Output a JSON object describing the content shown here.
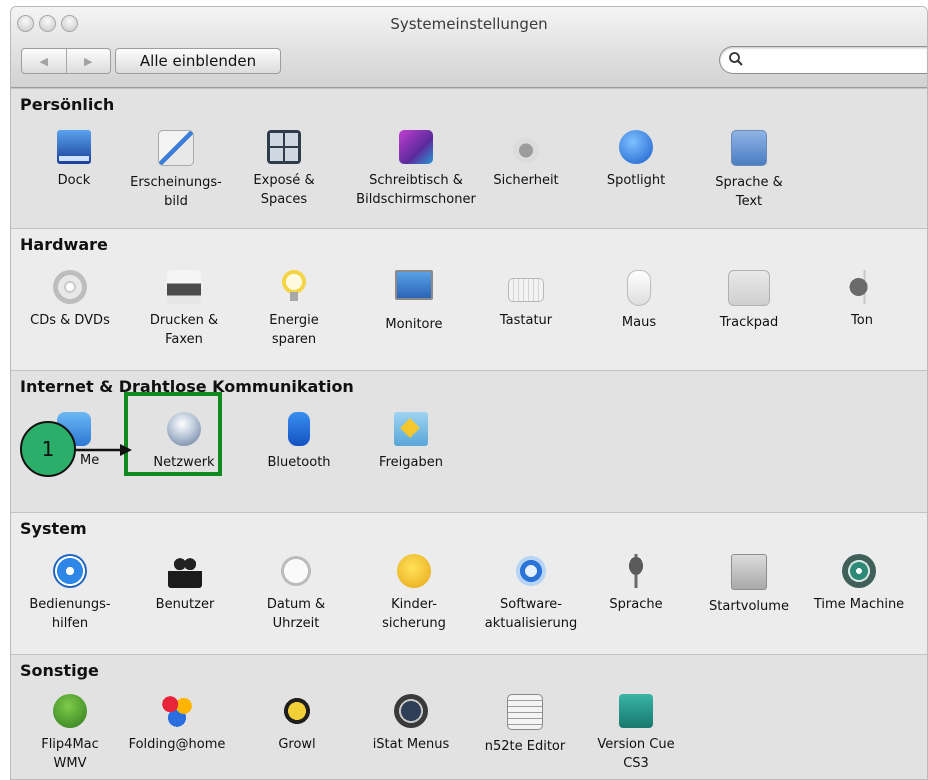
{
  "window": {
    "title": "Systemeinstellungen",
    "show_all_label": "Alle einblenden",
    "search_placeholder": ""
  },
  "sections": {
    "personal": {
      "title": "Persönlich",
      "items": [
        {
          "label": "Dock",
          "icon": "dock-icon"
        },
        {
          "label": "Erscheinungs-\nbild",
          "icon": "appearance-icon"
        },
        {
          "label": "Exposé &\nSpaces",
          "icon": "expose-spaces-icon"
        },
        {
          "label": "Schreibtisch &\nBildschirmschoner",
          "icon": "desktop-screensaver-icon"
        },
        {
          "label": "Sicherheit",
          "icon": "security-icon"
        },
        {
          "label": "Spotlight",
          "icon": "spotlight-icon"
        },
        {
          "label": "Sprache &\nText",
          "icon": "language-text-icon"
        }
      ]
    },
    "hardware": {
      "title": "Hardware",
      "items": [
        {
          "label": "CDs & DVDs",
          "icon": "cd-dvd-icon"
        },
        {
          "label": "Drucken &\nFaxen",
          "icon": "printer-icon"
        },
        {
          "label": "Energie\nsparen",
          "icon": "lightbulb-icon"
        },
        {
          "label": "Monitore",
          "icon": "monitor-icon"
        },
        {
          "label": "Tastatur",
          "icon": "keyboard-icon"
        },
        {
          "label": "Maus",
          "icon": "mouse-icon"
        },
        {
          "label": "Trackpad",
          "icon": "trackpad-icon"
        },
        {
          "label": "Ton",
          "icon": "speaker-icon"
        }
      ]
    },
    "internet": {
      "title": "Internet & Drahtlose Kommunikation",
      "items": [
        {
          "label": "Me",
          "icon": "mobileme-icon"
        },
        {
          "label": "Netzwerk",
          "icon": "network-globe-icon"
        },
        {
          "label": "Bluetooth",
          "icon": "bluetooth-icon"
        },
        {
          "label": "Freigaben",
          "icon": "sharing-folder-icon"
        }
      ]
    },
    "system": {
      "title": "System",
      "items": [
        {
          "label": "Bedienungs-\nhilfen",
          "icon": "accessibility-icon"
        },
        {
          "label": "Benutzer",
          "icon": "accounts-icon"
        },
        {
          "label": "Datum &\nUhrzeit",
          "icon": "date-time-icon"
        },
        {
          "label": "Kinder-\nsicherung",
          "icon": "parental-controls-icon"
        },
        {
          "label": "Software-\naktualisierung",
          "icon": "software-update-icon"
        },
        {
          "label": "Sprache",
          "icon": "microphone-icon"
        },
        {
          "label": "Startvolume",
          "icon": "startup-disk-icon"
        },
        {
          "label": "Time Machine",
          "icon": "time-machine-icon"
        }
      ]
    },
    "other": {
      "title": "Sonstige",
      "items": [
        {
          "label": "Flip4Mac\nWMV",
          "icon": "flip4mac-icon"
        },
        {
          "label": "Folding@home",
          "icon": "folding-home-icon"
        },
        {
          "label": "Growl",
          "icon": "growl-icon"
        },
        {
          "label": "iStat Menus",
          "icon": "istat-icon"
        },
        {
          "label": "n52te Editor",
          "icon": "n52te-icon"
        },
        {
          "label": "Version Cue\nCS3",
          "icon": "version-cue-icon"
        }
      ]
    }
  },
  "annotation": {
    "step_number": "1",
    "highlight_color": "#0f8a1f",
    "callout_color": "#2cae6b"
  }
}
